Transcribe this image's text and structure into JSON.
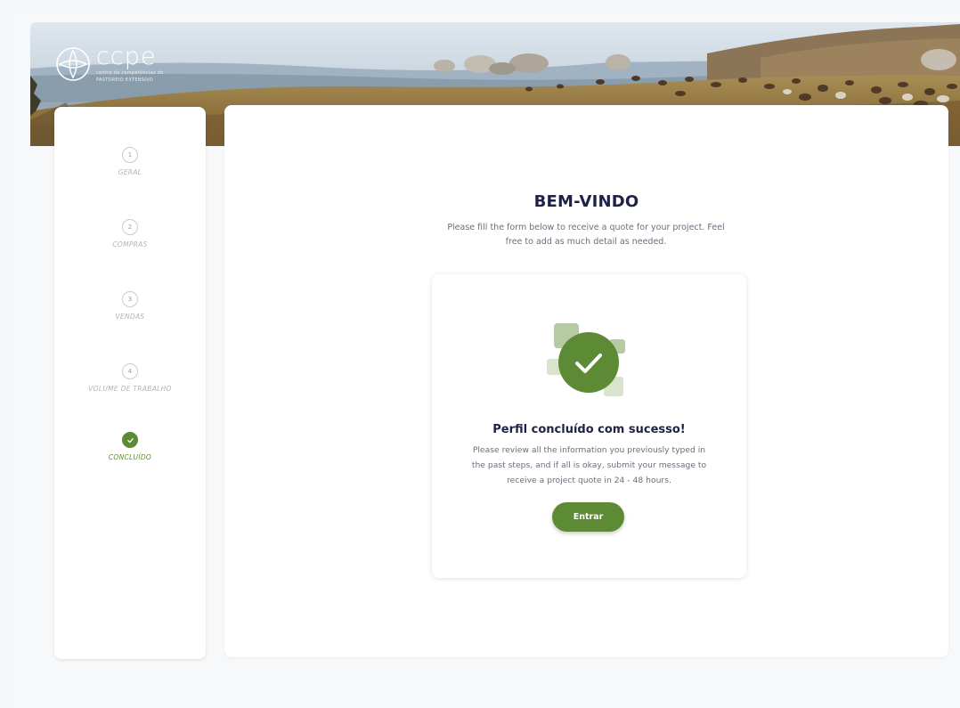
{
  "brand": {
    "logo_word": "ccpe",
    "logo_sub_line1": "centro de competências do",
    "logo_sub_line2": "PASTOREIO EXTENSIVO"
  },
  "steps": [
    {
      "number": "1",
      "label": "GERAL",
      "status": "pending"
    },
    {
      "number": "2",
      "label": "COMPRAS",
      "status": "pending"
    },
    {
      "number": "3",
      "label": "VENDAS",
      "status": "pending"
    },
    {
      "number": "4",
      "label": "VOLUME DE TRABALHO",
      "status": "pending"
    },
    {
      "number": "",
      "label": "CONCLUÍDO",
      "status": "done",
      "icon": "check-icon"
    }
  ],
  "main": {
    "title": "BEM-VINDO",
    "description": "Please fill the form below to receive a quote for your project. Feel free to add as much detail as needed."
  },
  "success_card": {
    "title": "Perfil concluído com sucesso!",
    "description": "Please review all the information you previously typed in the past steps, and if all is okay, submit your message to receive a project quote in 24 - 48 hours.",
    "button_label": "Entrar"
  },
  "colors": {
    "accent": "#5d8a35",
    "heading": "#1e2148",
    "muted": "#b2b4bc"
  }
}
